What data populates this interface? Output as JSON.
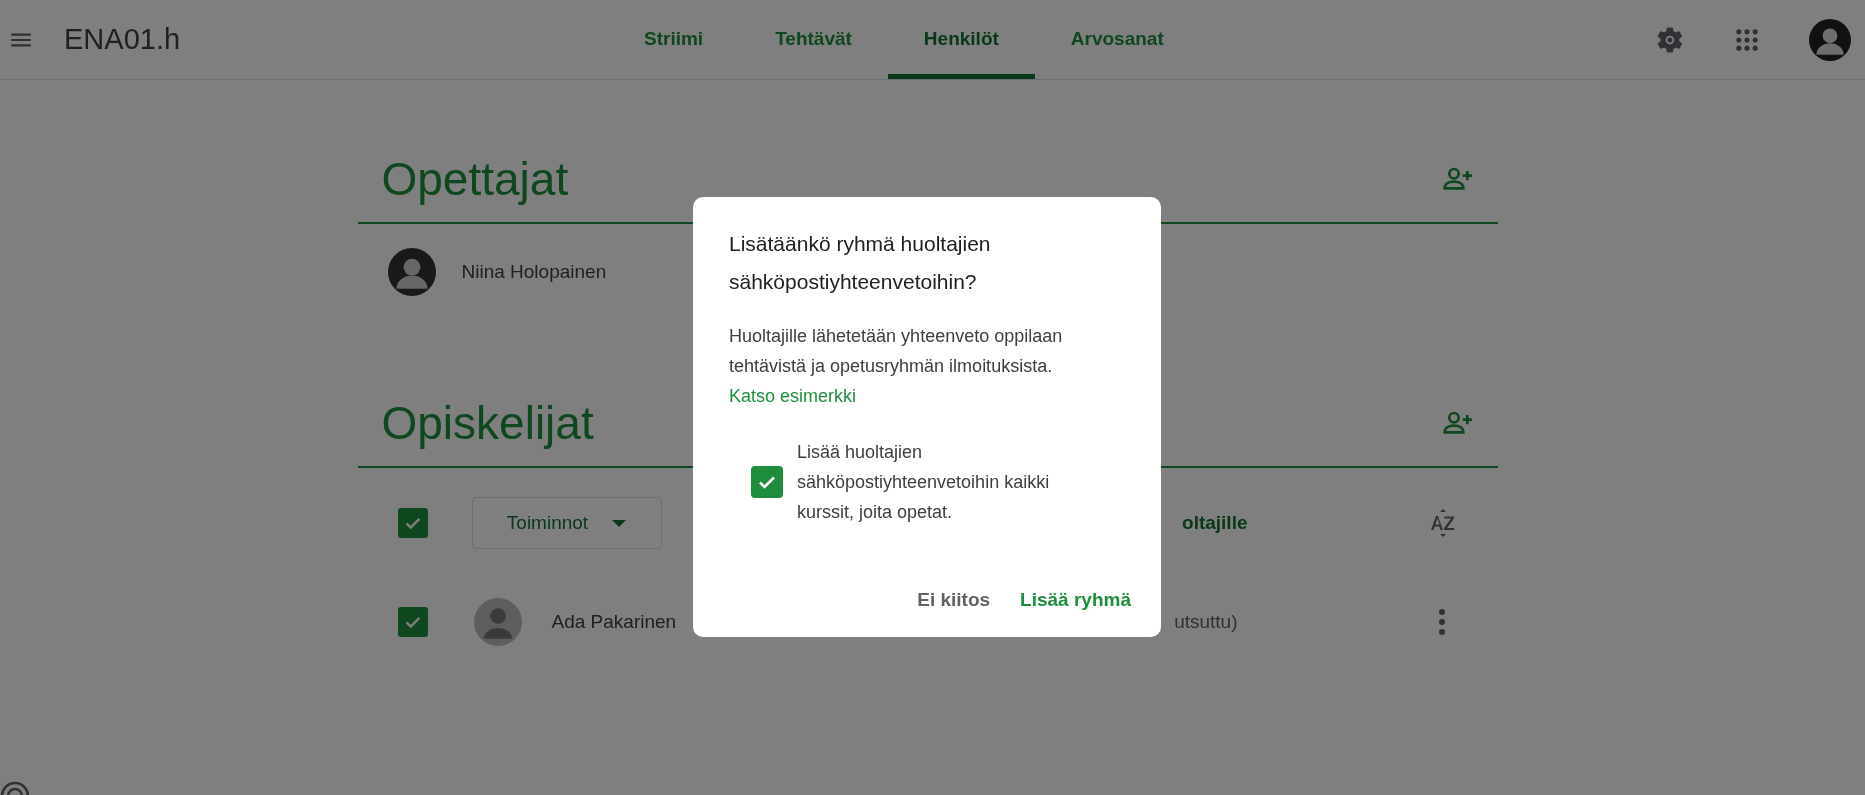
{
  "app_bar": {
    "title": "ENA01.h",
    "tabs": [
      {
        "label": "Striimi",
        "selected": false
      },
      {
        "label": "Tehtävät",
        "selected": false
      },
      {
        "label": "Henkilöt",
        "selected": true
      },
      {
        "label": "Arvosanat",
        "selected": false
      }
    ]
  },
  "teachers": {
    "heading": "Opettajat",
    "people": [
      {
        "name": "Niina Holopainen"
      }
    ]
  },
  "students": {
    "heading": "Opiskelijat",
    "select_all_checked": true,
    "actions_button": "Toiminnot",
    "guardians_label": "oltajille",
    "people": [
      {
        "name": "Ada Pakarinen",
        "checked": true,
        "status": "utsuttu)"
      }
    ]
  },
  "dialog": {
    "title": "Lisätäänkö ryhmä huoltajien sähköpostiyhteenvetoihin?",
    "body": "Huoltajille lähetetään yhteenveto oppilaan tehtävistä ja opetusryhmän ilmoituksista.",
    "link": "Katso esimerkki",
    "checkbox": {
      "label": "Lisää huoltajien sähköpostiyhteenvetoihin kaikki kurssit, joita opetat.",
      "checked": true
    },
    "buttons": [
      {
        "label": "Ei kiitos",
        "kind": "secondary"
      },
      {
        "label": "Lisää ryhmä",
        "kind": "primary"
      }
    ]
  }
}
